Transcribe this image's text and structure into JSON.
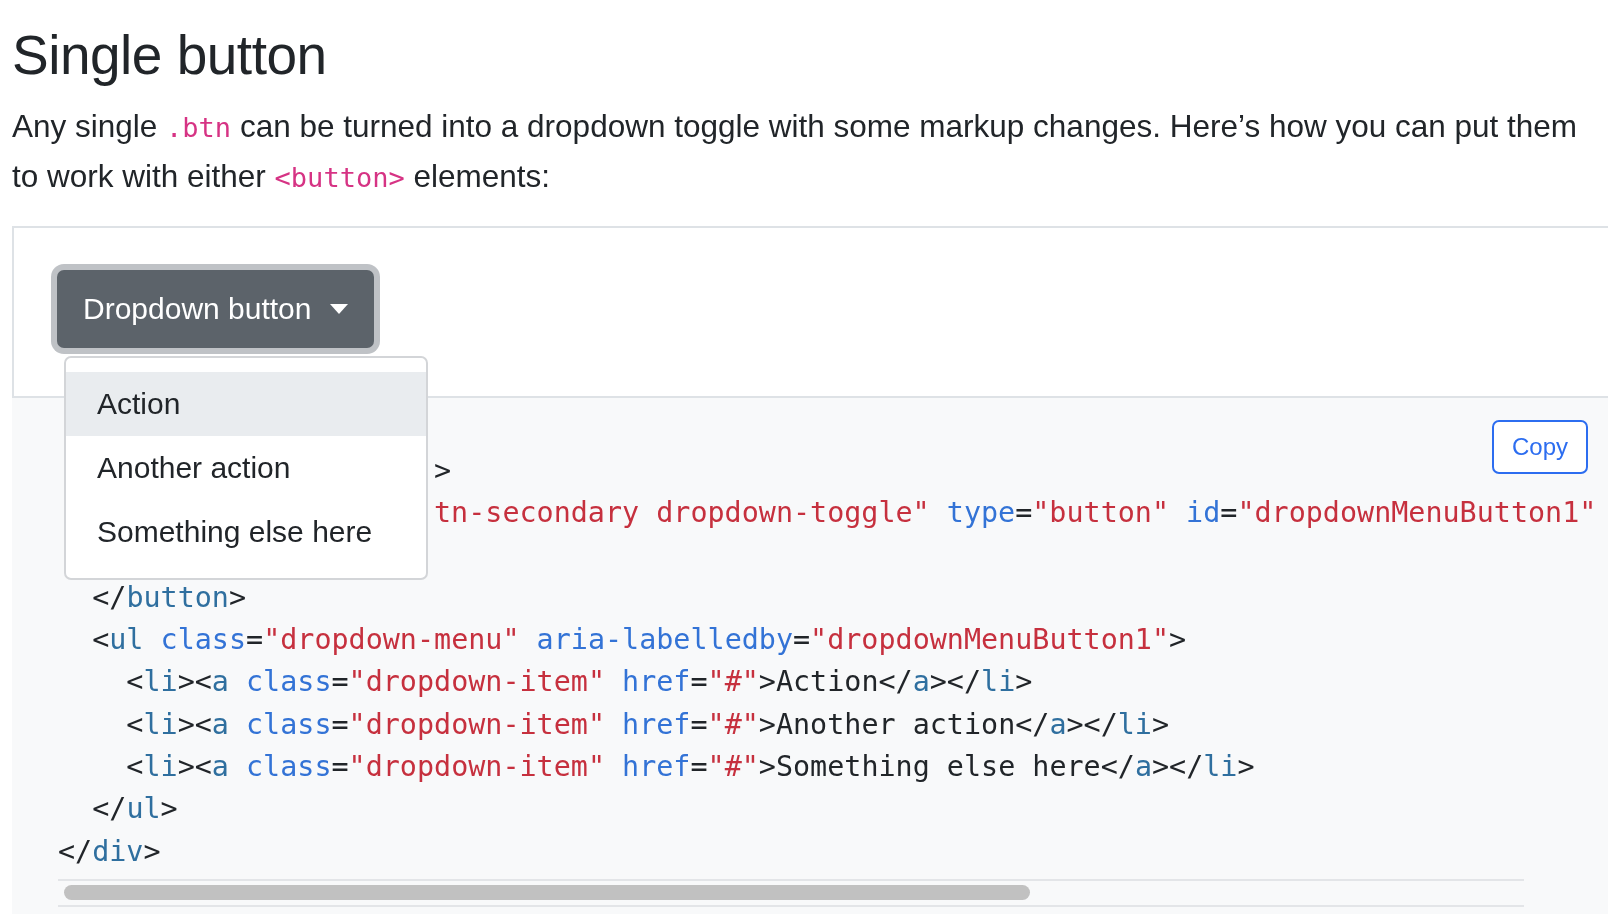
{
  "heading": "Single button",
  "intro": [
    {
      "text": "Any single ",
      "code": false
    },
    {
      "text": ".btn",
      "code": true
    },
    {
      "text": " can be turned into a dropdown toggle with some markup changes. Here’s how you can put them to work with either ",
      "code": false
    },
    {
      "text": "<button>",
      "code": true
    },
    {
      "text": " elements:",
      "code": false
    }
  ],
  "dropdown": {
    "label": "Dropdown button",
    "items": [
      {
        "label": "Action",
        "selected": true
      },
      {
        "label": "Another action",
        "selected": false
      },
      {
        "label": "Something else here",
        "selected": false
      }
    ]
  },
  "copy_button": "Copy",
  "code_lines": [
    {
      "kind": "split",
      "right": [
        {
          "kind": "punct",
          "text": ">"
        }
      ]
    },
    {
      "kind": "split",
      "right": [
        {
          "kind": "string",
          "text": "tn-secondary dropdown-toggle\""
        },
        {
          "kind": "attr",
          "text": " type"
        },
        {
          "kind": "punct",
          "text": "="
        },
        {
          "kind": "string",
          "text": "\"button\""
        },
        {
          "kind": "attr",
          "text": " id"
        },
        {
          "kind": "punct",
          "text": "="
        },
        {
          "kind": "string",
          "text": "\"dropdownMenuButton1\""
        }
      ]
    },
    {
      "kind": "covered"
    },
    {
      "kind": "full",
      "left": [
        {
          "kind": "punct",
          "text": "  </"
        },
        {
          "kind": "tag",
          "text": "button"
        },
        {
          "kind": "punct",
          "text": ">"
        }
      ]
    },
    {
      "kind": "full",
      "left": [
        {
          "kind": "punct",
          "text": "  <"
        },
        {
          "kind": "tag",
          "text": "ul"
        },
        {
          "kind": "attr",
          "text": " class"
        },
        {
          "kind": "punct",
          "text": "="
        },
        {
          "kind": "string",
          "text": "\"dropdown-menu\""
        },
        {
          "kind": "attr",
          "text": " aria-labelledby"
        },
        {
          "kind": "punct",
          "text": "="
        },
        {
          "kind": "string",
          "text": "\"dropdownMenuButton1\""
        },
        {
          "kind": "punct",
          "text": ">"
        }
      ]
    },
    {
      "kind": "full",
      "left": [
        {
          "kind": "punct",
          "text": "    <"
        },
        {
          "kind": "tag",
          "text": "li"
        },
        {
          "kind": "punct",
          "text": "><"
        },
        {
          "kind": "tag",
          "text": "a"
        },
        {
          "kind": "attr",
          "text": " class"
        },
        {
          "kind": "punct",
          "text": "="
        },
        {
          "kind": "string",
          "text": "\"dropdown-item\""
        },
        {
          "kind": "attr",
          "text": " href"
        },
        {
          "kind": "punct",
          "text": "="
        },
        {
          "kind": "string",
          "text": "\"#\""
        },
        {
          "kind": "punct",
          "text": ">"
        },
        {
          "kind": "text",
          "text": "Action"
        },
        {
          "kind": "punct",
          "text": "</"
        },
        {
          "kind": "tag",
          "text": "a"
        },
        {
          "kind": "punct",
          "text": "></"
        },
        {
          "kind": "tag",
          "text": "li"
        },
        {
          "kind": "punct",
          "text": ">"
        }
      ]
    },
    {
      "kind": "full",
      "left": [
        {
          "kind": "punct",
          "text": "    <"
        },
        {
          "kind": "tag",
          "text": "li"
        },
        {
          "kind": "punct",
          "text": "><"
        },
        {
          "kind": "tag",
          "text": "a"
        },
        {
          "kind": "attr",
          "text": " class"
        },
        {
          "kind": "punct",
          "text": "="
        },
        {
          "kind": "string",
          "text": "\"dropdown-item\""
        },
        {
          "kind": "attr",
          "text": " href"
        },
        {
          "kind": "punct",
          "text": "="
        },
        {
          "kind": "string",
          "text": "\"#\""
        },
        {
          "kind": "punct",
          "text": ">"
        },
        {
          "kind": "text",
          "text": "Another action"
        },
        {
          "kind": "punct",
          "text": "</"
        },
        {
          "kind": "tag",
          "text": "a"
        },
        {
          "kind": "punct",
          "text": "></"
        },
        {
          "kind": "tag",
          "text": "li"
        },
        {
          "kind": "punct",
          "text": ">"
        }
      ]
    },
    {
      "kind": "full",
      "left": [
        {
          "kind": "punct",
          "text": "    <"
        },
        {
          "kind": "tag",
          "text": "li"
        },
        {
          "kind": "punct",
          "text": "><"
        },
        {
          "kind": "tag",
          "text": "a"
        },
        {
          "kind": "attr",
          "text": " class"
        },
        {
          "kind": "punct",
          "text": "="
        },
        {
          "kind": "string",
          "text": "\"dropdown-item\""
        },
        {
          "kind": "attr",
          "text": " href"
        },
        {
          "kind": "punct",
          "text": "="
        },
        {
          "kind": "string",
          "text": "\"#\""
        },
        {
          "kind": "punct",
          "text": ">"
        },
        {
          "kind": "text",
          "text": "Something else here"
        },
        {
          "kind": "punct",
          "text": "</"
        },
        {
          "kind": "tag",
          "text": "a"
        },
        {
          "kind": "punct",
          "text": "></"
        },
        {
          "kind": "tag",
          "text": "li"
        },
        {
          "kind": "punct",
          "text": ">"
        }
      ]
    },
    {
      "kind": "full",
      "left": [
        {
          "kind": "punct",
          "text": "  </"
        },
        {
          "kind": "tag",
          "text": "ul"
        },
        {
          "kind": "punct",
          "text": ">"
        }
      ]
    },
    {
      "kind": "full",
      "left": [
        {
          "kind": "punct",
          "text": "</"
        },
        {
          "kind": "tag",
          "text": "div"
        },
        {
          "kind": "punct",
          "text": ">"
        }
      ]
    }
  ]
}
